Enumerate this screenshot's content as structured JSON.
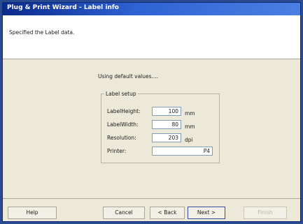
{
  "window": {
    "title": "Plug & Print Wizard - Label info"
  },
  "header": {
    "description": "Specified the Label data."
  },
  "main": {
    "status_text": "Using default values....",
    "group_title": "Label setup",
    "fields": [
      {
        "label": "LabelHeight:",
        "value": "100",
        "unit": "mm"
      },
      {
        "label": "LabelWidth:",
        "value": "80",
        "unit": "mm"
      },
      {
        "label": "Resolution:",
        "value": "203",
        "unit": "dpi"
      },
      {
        "label": "Printer:",
        "value": "P4",
        "unit": ""
      }
    ]
  },
  "buttons": {
    "help": "Help",
    "cancel": "Cancel",
    "back": "< Back",
    "next": "Next >",
    "finish": "Finish"
  }
}
